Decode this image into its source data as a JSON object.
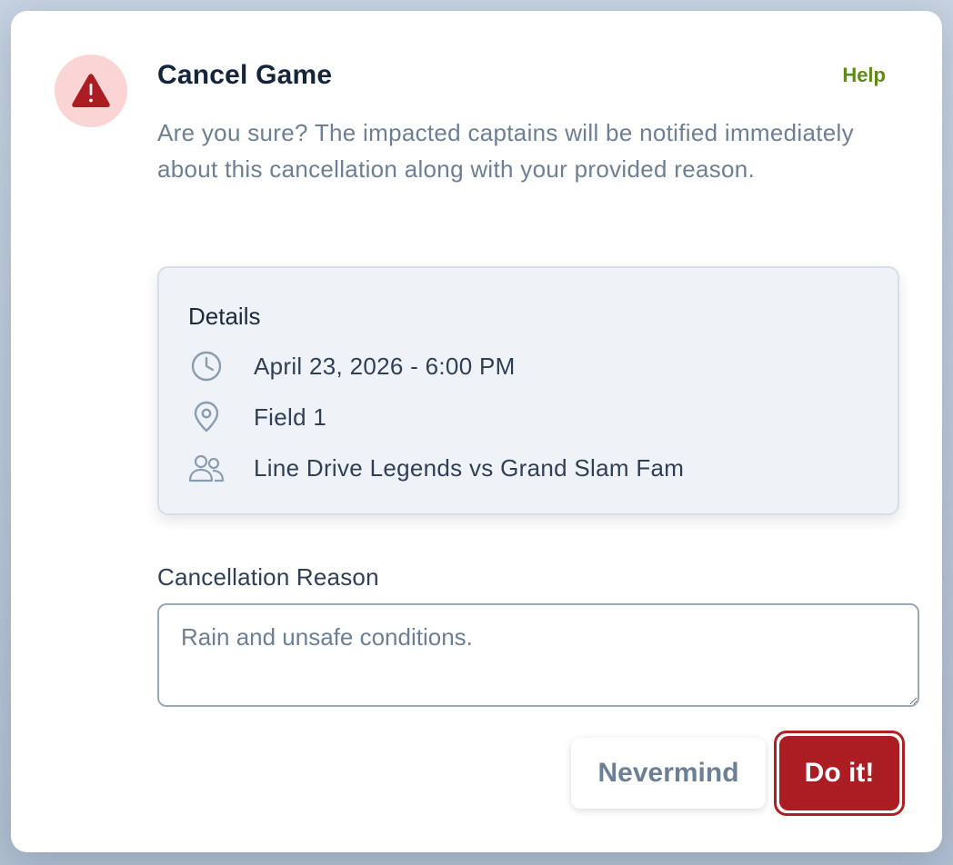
{
  "dialog": {
    "title": "Cancel Game",
    "help_label": "Help",
    "description": "Are you sure? The impacted captains will be notified immediately about this cancellation along with your provided reason."
  },
  "details": {
    "title": "Details",
    "datetime": "April 23, 2026 - 6:00 PM",
    "location": "Field 1",
    "matchup": "Line Drive Legends vs Grand Slam Fam"
  },
  "form": {
    "reason_label": "Cancellation Reason",
    "reason_value": "Rain and unsafe conditions."
  },
  "actions": {
    "cancel_label": "Nevermind",
    "confirm_label": "Do it!"
  },
  "colors": {
    "danger": "#ab1d22",
    "danger_soft": "#fbd5d5",
    "help_link": "#5f8a1a",
    "title_text": "#14243b",
    "muted_text": "#6b7f95"
  },
  "icons": {
    "warning": "warning-triangle-icon",
    "clock": "clock-icon",
    "location": "map-pin-icon",
    "teams": "users-icon"
  }
}
